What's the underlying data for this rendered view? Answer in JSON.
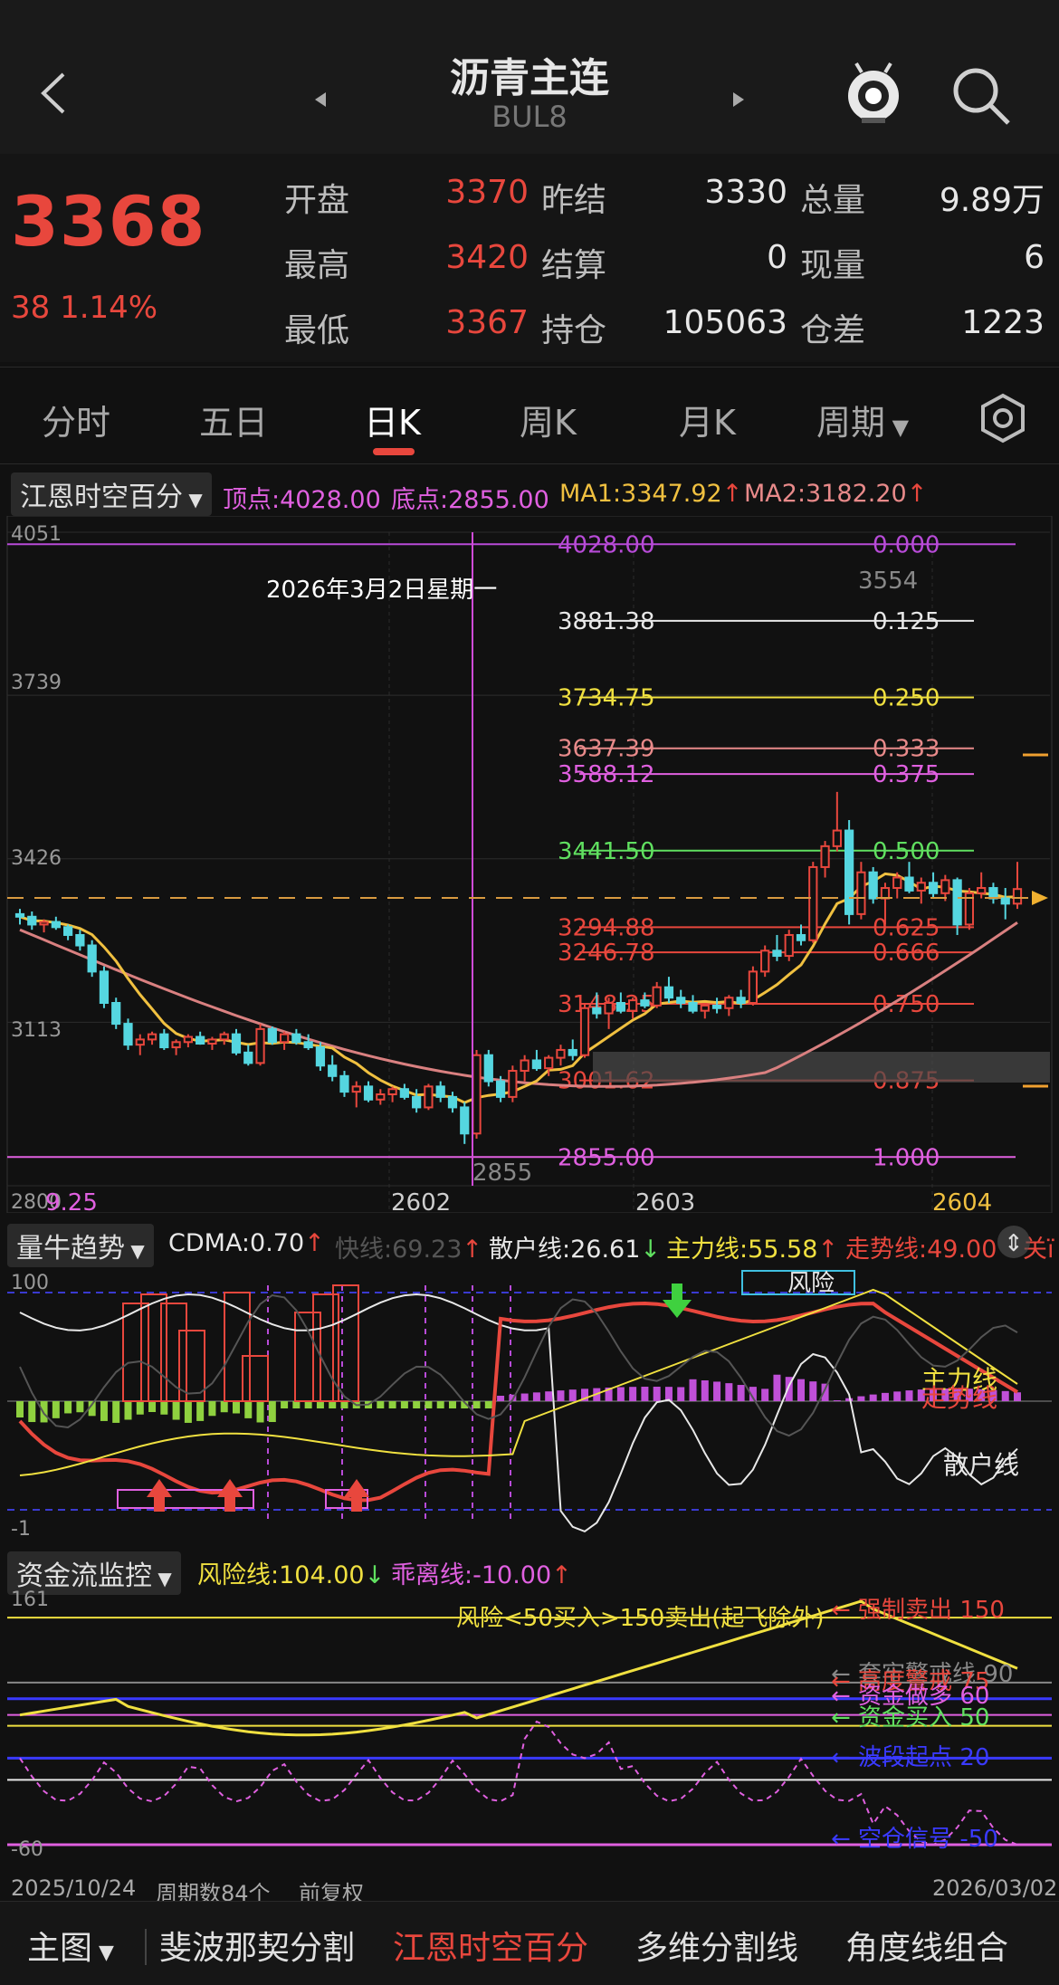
{
  "header": {
    "title": "沥青主连",
    "code": "BUL8",
    "back_icon": "chevron-left-icon",
    "search_icon": "search-icon",
    "mascot_icon": "mascot-icon"
  },
  "quote": {
    "price": "3368",
    "change": "38",
    "change_pct": "1.14%",
    "rows": [
      [
        {
          "label": "开盘",
          "value": "3370",
          "color": "red"
        },
        {
          "label": "昨结",
          "value": "3330",
          "color": "white"
        },
        {
          "label": "总量",
          "value": "9.89万",
          "color": "white"
        }
      ],
      [
        {
          "label": "最高",
          "value": "3420",
          "color": "red"
        },
        {
          "label": "结算",
          "value": "0",
          "color": "white"
        },
        {
          "label": "现量",
          "value": "6",
          "color": "white"
        }
      ],
      [
        {
          "label": "最低",
          "value": "3367",
          "color": "red"
        },
        {
          "label": "持仓",
          "value": "105063",
          "color": "white"
        },
        {
          "label": "仓差",
          "value": "1223",
          "color": "white"
        }
      ]
    ]
  },
  "tabs": [
    "分时",
    "五日",
    "日K",
    "周K",
    "月K",
    "周期"
  ],
  "active_tab": "日K",
  "main_chart": {
    "indicator": "江恩时空百分",
    "top": "顶点:4028.00",
    "bottom": "底点:2855.00",
    "ma1": "MA1:3347.92",
    "ma2": "MA2:3182.20",
    "y_ticks": [
      "4051",
      "3739",
      "3426",
      "3113",
      "2800"
    ],
    "date_tip": "2026年3月2日星期一",
    "bottom_left": "9.25",
    "x_ticks": [
      "2602",
      "2603",
      "2604"
    ],
    "hi_label": "3554",
    "lo_label": "2855",
    "levels": [
      {
        "price": "4028.00",
        "ratio": "0.000",
        "color": "#b84bd8"
      },
      {
        "price": "3881.38",
        "ratio": "0.125",
        "color": "#e8e8e8"
      },
      {
        "price": "3734.75",
        "ratio": "0.250",
        "color": "#f0e040"
      },
      {
        "price": "3637.39",
        "ratio": "0.333",
        "color": "#e88a8a"
      },
      {
        "price": "3588.12",
        "ratio": "0.375",
        "color": "#e060e0"
      },
      {
        "price": "3441.50",
        "ratio": "0.500",
        "color": "#60e060"
      },
      {
        "price": "3294.88",
        "ratio": "0.625",
        "color": "#e8473d"
      },
      {
        "price": "3246.78",
        "ratio": "0.666",
        "color": "#e8473d"
      },
      {
        "price": "3148.25",
        "ratio": "0.750",
        "color": "#e8473d"
      },
      {
        "price": "3001.62",
        "ratio": "0.875",
        "color": "#e8473d"
      },
      {
        "price": "2855.00",
        "ratio": "1.000",
        "color": "#e060e0"
      }
    ]
  },
  "chart_data": {
    "type": "candlestick",
    "title": "沥青主连 BUL8 日K",
    "x_ticks": [
      "2602",
      "2603",
      "2604"
    ],
    "ylim": [
      2800,
      4051
    ],
    "high_point": 3554,
    "low_point": 2855,
    "last": 3368,
    "candles": [
      [
        3320,
        3330,
        3300,
        3315
      ],
      [
        3315,
        3325,
        3290,
        3300
      ],
      [
        3300,
        3310,
        3285,
        3305
      ],
      [
        3305,
        3315,
        3290,
        3295
      ],
      [
        3295,
        3300,
        3270,
        3280
      ],
      [
        3280,
        3290,
        3250,
        3260
      ],
      [
        3260,
        3270,
        3200,
        3210
      ],
      [
        3210,
        3220,
        3140,
        3150
      ],
      [
        3150,
        3160,
        3100,
        3110
      ],
      [
        3110,
        3120,
        3060,
        3070
      ],
      [
        3070,
        3090,
        3050,
        3080
      ],
      [
        3080,
        3095,
        3070,
        3090
      ],
      [
        3090,
        3100,
        3060,
        3065
      ],
      [
        3065,
        3080,
        3050,
        3075
      ],
      [
        3075,
        3090,
        3065,
        3085
      ],
      [
        3085,
        3095,
        3070,
        3072
      ],
      [
        3072,
        3085,
        3060,
        3080
      ],
      [
        3080,
        3095,
        3070,
        3090
      ],
      [
        3090,
        3100,
        3050,
        3055
      ],
      [
        3055,
        3070,
        3030,
        3035
      ],
      [
        3035,
        3110,
        3030,
        3100
      ],
      [
        3100,
        3105,
        3070,
        3075
      ],
      [
        3075,
        3095,
        3060,
        3090
      ],
      [
        3090,
        3100,
        3070,
        3075
      ],
      [
        3075,
        3090,
        3060,
        3065
      ],
      [
        3065,
        3075,
        3020,
        3030
      ],
      [
        3030,
        3050,
        3000,
        3010
      ],
      [
        3010,
        3020,
        2970,
        2980
      ],
      [
        2980,
        3000,
        2950,
        2990
      ],
      [
        2990,
        3000,
        2960,
        2965
      ],
      [
        2965,
        2985,
        2955,
        2975
      ],
      [
        2975,
        2990,
        2960,
        2985
      ],
      [
        2985,
        2995,
        2965,
        2970
      ],
      [
        2970,
        2985,
        2940,
        2950
      ],
      [
        2950,
        2995,
        2945,
        2990
      ],
      [
        2990,
        3000,
        2960,
        2970
      ],
      [
        2970,
        2980,
        2940,
        2950
      ],
      [
        2950,
        2960,
        2880,
        2900
      ],
      [
        2900,
        3060,
        2890,
        3050
      ],
      [
        3050,
        3060,
        2990,
        3000
      ],
      [
        3000,
        3010,
        2960,
        2970
      ],
      [
        2970,
        3030,
        2960,
        3020
      ],
      [
        3020,
        3050,
        3000,
        3040
      ],
      [
        3040,
        3060,
        3020,
        3025
      ],
      [
        3025,
        3050,
        3010,
        3045
      ],
      [
        3045,
        3070,
        3030,
        3060
      ],
      [
        3060,
        3080,
        3040,
        3050
      ],
      [
        3050,
        3150,
        3045,
        3140
      ],
      [
        3140,
        3170,
        3120,
        3130
      ],
      [
        3130,
        3160,
        3100,
        3150
      ],
      [
        3150,
        3170,
        3130,
        3135
      ],
      [
        3135,
        3160,
        3120,
        3155
      ],
      [
        3155,
        3170,
        3140,
        3145
      ],
      [
        3145,
        3190,
        3140,
        3180
      ],
      [
        3180,
        3200,
        3150,
        3160
      ],
      [
        3160,
        3175,
        3140,
        3150
      ],
      [
        3150,
        3165,
        3130,
        3135
      ],
      [
        3135,
        3150,
        3120,
        3145
      ],
      [
        3145,
        3160,
        3130,
        3140
      ],
      [
        3140,
        3165,
        3125,
        3160
      ],
      [
        3160,
        3175,
        3140,
        3150
      ],
      [
        3150,
        3220,
        3145,
        3210
      ],
      [
        3210,
        3260,
        3200,
        3250
      ],
      [
        3250,
        3280,
        3230,
        3240
      ],
      [
        3240,
        3290,
        3230,
        3280
      ],
      [
        3280,
        3300,
        3260,
        3270
      ],
      [
        3270,
        3420,
        3265,
        3410
      ],
      [
        3410,
        3460,
        3390,
        3450
      ],
      [
        3450,
        3554,
        3440,
        3480
      ],
      [
        3480,
        3500,
        3300,
        3320
      ],
      [
        3320,
        3420,
        3310,
        3400
      ],
      [
        3400,
        3410,
        3340,
        3350
      ],
      [
        3350,
        3380,
        3300,
        3370
      ],
      [
        3370,
        3400,
        3350,
        3390
      ],
      [
        3390,
        3420,
        3360,
        3365
      ],
      [
        3365,
        3390,
        3340,
        3380
      ],
      [
        3380,
        3400,
        3350,
        3360
      ],
      [
        3360,
        3395,
        3345,
        3385
      ],
      [
        3385,
        3390,
        3280,
        3300
      ],
      [
        3300,
        3370,
        3290,
        3360
      ],
      [
        3360,
        3400,
        3350,
        3370
      ],
      [
        3370,
        3380,
        3340,
        3350
      ],
      [
        3350,
        3370,
        3310,
        3340
      ],
      [
        3340,
        3420,
        3330,
        3368
      ]
    ]
  },
  "vol_chart": {
    "indicator": "量牛趋势",
    "cdma": "CDMA:0.70",
    "kuai": "快线:69.23",
    "sanhu": "散户线:26.61",
    "zhuli": "主力线:55.58",
    "zoushi": "走势线:49.00",
    "close_label": "关ï",
    "y_top": "100",
    "y_bottom": "-1",
    "label_zhuli": "主力线",
    "label_zoushi": "走势线",
    "label_sanhu": "散户线",
    "label_fengxian": "风险"
  },
  "flow_chart": {
    "indicator": "资金流监控",
    "risk": "风险线:104.00",
    "deviation": "乖离线:-10.00",
    "y_top": "161",
    "y_bottom": "-60",
    "note": "风险<50买入>150卖出(起飞除外)",
    "line_labels": [
      {
        "text": "强制卖出 150",
        "color": "#e8473d",
        "y": 1787
      },
      {
        "text": "套牢警戒线 90",
        "color": "#888888",
        "y": 1858
      },
      {
        "text": "高度警戒 75",
        "color": "#e8473d",
        "y": 1866
      },
      {
        "text": "资金做多 60",
        "color": "#e060e0",
        "y": 1882
      },
      {
        "text": "资金买入 50",
        "color": "#60e060",
        "y": 1906
      },
      {
        "text": "波段起点 20",
        "color": "#3a3aff",
        "y": 1950
      },
      {
        "text": "空仓信号 -50",
        "color": "#3a3aff",
        "y": 2040
      }
    ],
    "start_date": "2025/10/24",
    "period_count": "周期数84个",
    "adjust": "前复权",
    "end_date": "2026/03/02"
  },
  "bottom_tabs": [
    "主图",
    "斐波那契分割",
    "江恩时空百分",
    "多维分割线",
    "角度线组合"
  ],
  "bottom_active": "江恩时空百分"
}
